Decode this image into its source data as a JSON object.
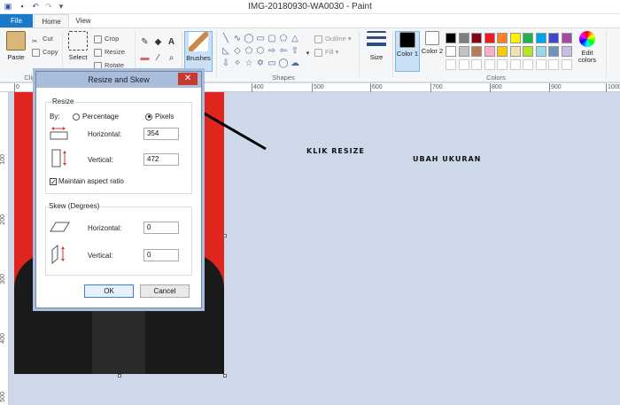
{
  "window": {
    "title": "IMG-20180930-WA0030 - Paint"
  },
  "tabs": {
    "file": "File",
    "home": "Home",
    "view": "View"
  },
  "ribbon": {
    "paste": "Paste",
    "cut": "Cut",
    "copy": "Copy",
    "clipboard_group": "Clipbo",
    "select": "Select",
    "crop": "Crop",
    "resize": "Resize",
    "rotate": "Rotate",
    "brushes": "Brushes",
    "outline": "Outline",
    "fill": "Fill",
    "shapes_group": "Shapes",
    "size": "Size",
    "color1": "Color 1",
    "color2": "Color 2",
    "colors_group": "Colors",
    "edit_colors": "Edit colors",
    "palette_row1": [
      "#000000",
      "#7f7f7f",
      "#880015",
      "#ed1c24",
      "#ff7f27",
      "#fff200",
      "#22b14c",
      "#00a2e8",
      "#3f48cc",
      "#a349a4"
    ],
    "palette_row2": [
      "#ffffff",
      "#c3c3c3",
      "#b97a57",
      "#ffaec9",
      "#ffc90e",
      "#efe4b0",
      "#b5e61d",
      "#99d9ea",
      "#7092be",
      "#c8bfe7"
    ]
  },
  "ruler": {
    "h_ticks": [
      "0",
      "400",
      "500",
      "600",
      "700",
      "800",
      "900",
      "1000"
    ],
    "v_ticks": [
      "100",
      "200",
      "300",
      "400",
      "500"
    ]
  },
  "dialog": {
    "title": "Resize and Skew",
    "close": "✕",
    "resize_legend": "Resize",
    "by_label": "By:",
    "percentage": "Percentage",
    "pixels": "Pixels",
    "horizontal_label": "Horizontal:",
    "horizontal_value": "354",
    "vertical_label": "Vertical:",
    "vertical_value": "472",
    "maintain_aspect": "Maintain aspect ratio",
    "skew_legend": "Skew (Degrees)",
    "skew_horizontal_label": "Horizontal:",
    "skew_horizontal_value": "0",
    "skew_vertical_label": "Vertical:",
    "skew_vertical_value": "0",
    "ok": "OK",
    "cancel": "Cancel"
  },
  "annotations": {
    "klik_resize": "KLIK RESIZE",
    "ubah_ukuran": "UBAH UKURAN"
  },
  "colors": {
    "accent": "#1979ca",
    "canvas_bg": "#e0241e",
    "dialog_frame": "#a9bcd9",
    "close_red": "#c73b32"
  }
}
